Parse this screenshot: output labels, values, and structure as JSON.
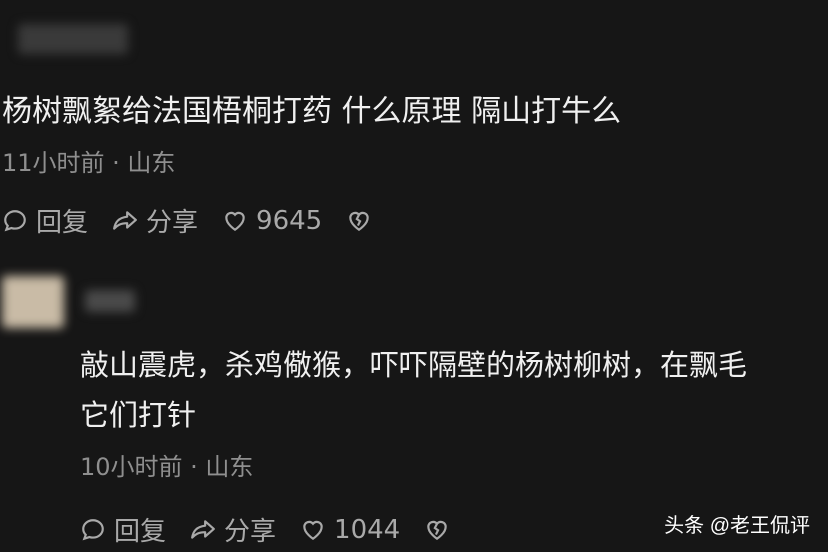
{
  "comment1": {
    "text": "杨树飘絮给法国梧桐打药 什么原理 隔山打牛么",
    "meta": "11小时前 · 山东",
    "actions": {
      "reply_label": "回复",
      "share_label": "分享",
      "like_count": "9645"
    }
  },
  "comment2": {
    "text_line1": "敲山震虎，杀鸡儆猴，吓吓隔壁的杨树柳树，在飘毛",
    "text_line2": "它们打针",
    "meta": "10小时前 · 山东",
    "actions": {
      "reply_label": "回复",
      "share_label": "分享",
      "like_count": "1044"
    }
  },
  "watermark": "头条 @老王侃评",
  "icons": {
    "reply": "comment-bubble-icon",
    "share": "share-arrow-icon",
    "like": "heart-icon",
    "dislike": "broken-heart-icon"
  },
  "colors": {
    "background": "#161616",
    "primary_text": "#f0f0f0",
    "secondary_text": "#8f8f8f",
    "action_text": "#a9a9a9"
  }
}
